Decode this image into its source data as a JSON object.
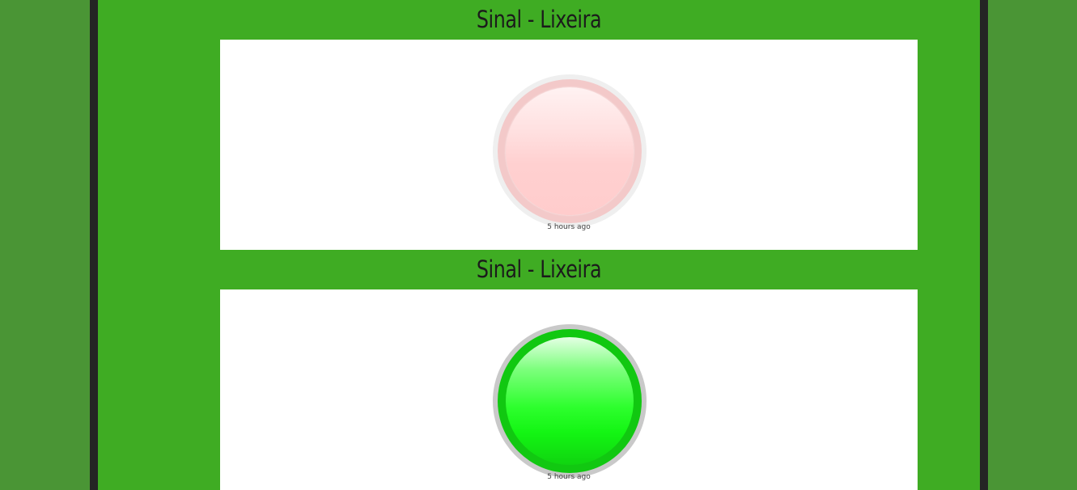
{
  "widgets": [
    {
      "title": "Sinal - Lixeira",
      "state": "off",
      "color": "#ffcccc",
      "timestamp": "5 hours ago"
    },
    {
      "title": "Sinal - Lixeira",
      "state": "on",
      "color": "#1aff1a",
      "timestamp": "5 hours ago"
    }
  ],
  "colors": {
    "page_background": "#4a9535",
    "frame": "#242424",
    "content_background": "#3fac23",
    "panel_background": "#ffffff"
  }
}
